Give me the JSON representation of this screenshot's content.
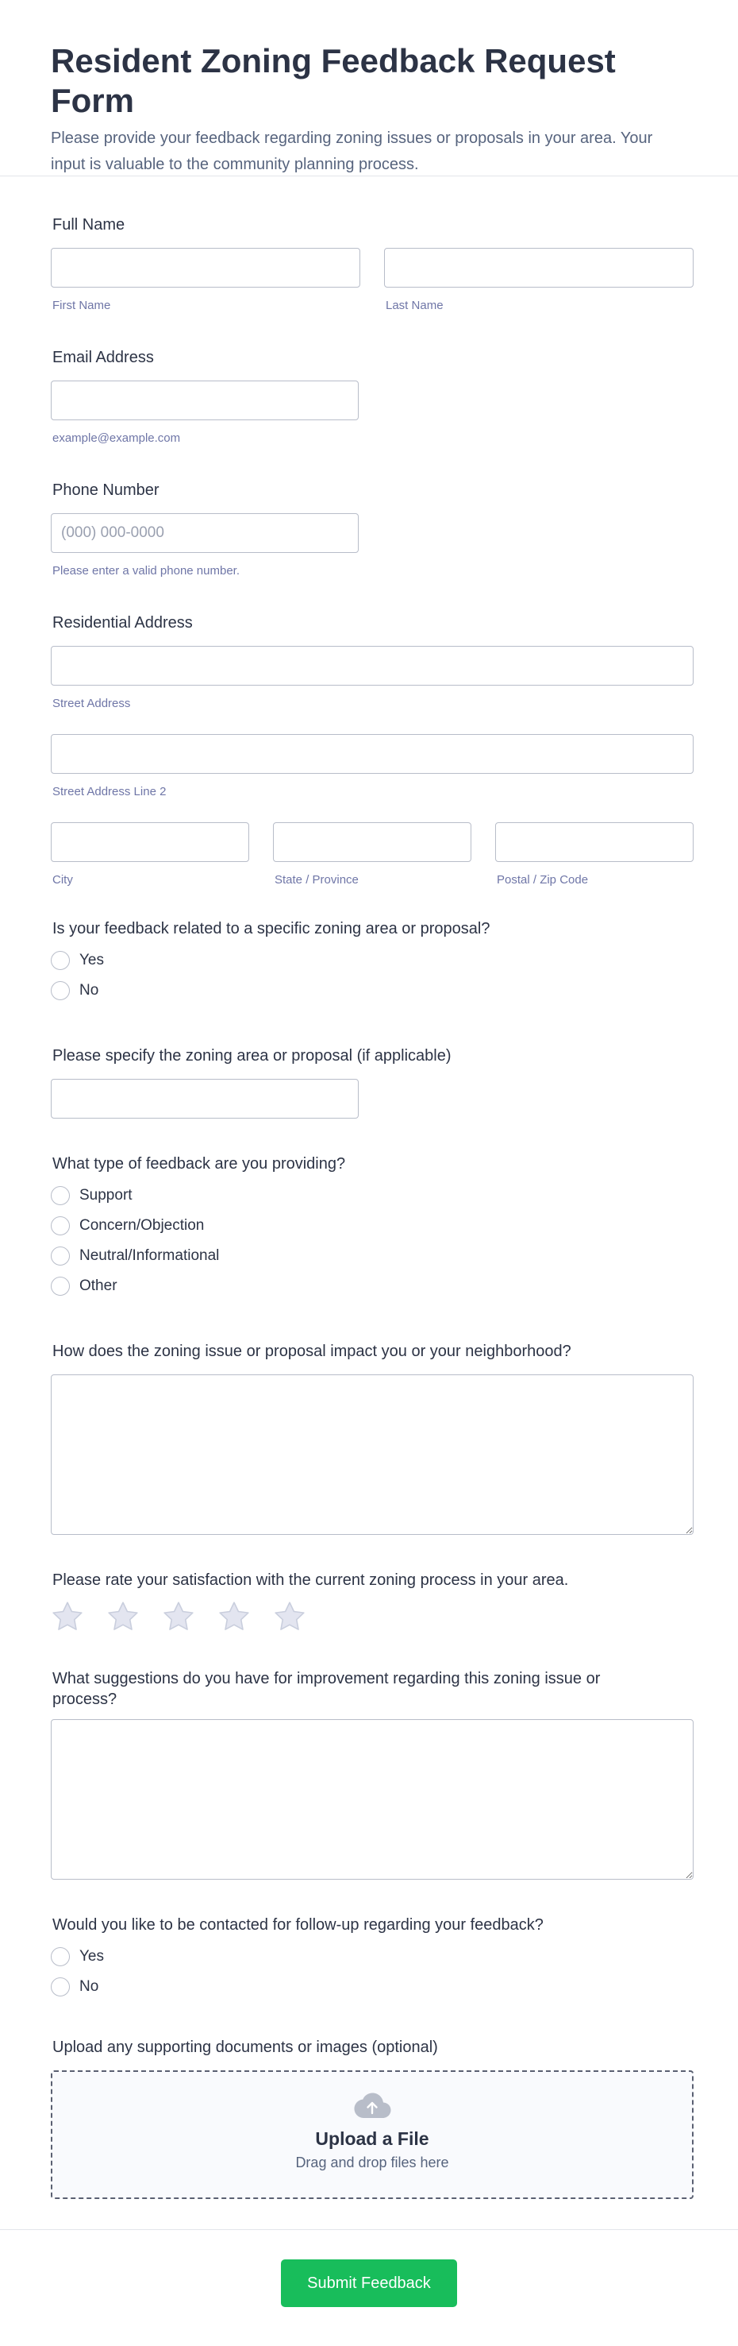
{
  "header": {
    "title": "Resident Zoning Feedback Request Form",
    "description": "Please provide your feedback regarding zoning issues or proposals in your area. Your input is valuable to the community planning process."
  },
  "full_name": {
    "label": "Full Name",
    "first_sublabel": "First Name",
    "last_sublabel": "Last Name",
    "first_value": "",
    "last_value": ""
  },
  "email": {
    "label": "Email Address",
    "sublabel": "example@example.com",
    "value": ""
  },
  "phone": {
    "label": "Phone Number",
    "placeholder": "(000) 000-0000",
    "sublabel": "Please enter a valid phone number."
  },
  "address": {
    "label": "Residential Address",
    "street_sublabel": "Street Address",
    "street2_sublabel": "Street Address Line 2",
    "city_sublabel": "City",
    "state_sublabel": "State / Province",
    "zip_sublabel": "Postal / Zip Code"
  },
  "related": {
    "label": "Is your feedback related to a specific zoning area or proposal?",
    "options": [
      "Yes",
      "No"
    ]
  },
  "specify": {
    "label": "Please specify the zoning area or proposal (if applicable)"
  },
  "feedback_type": {
    "label": "What type of feedback are you providing?",
    "options": [
      "Support",
      "Concern/Objection",
      "Neutral/Informational",
      "Other"
    ]
  },
  "impact": {
    "label": "How does the zoning issue or proposal impact you or your neighborhood?"
  },
  "rating": {
    "label": "Please rate your satisfaction with the current zoning process in your area.",
    "value": 0,
    "max": 5,
    "star_color": "#e3e5f0",
    "star_stroke": "#c9cedd"
  },
  "suggestions": {
    "label": "What suggestions do you have for improvement regarding this zoning issue or process?"
  },
  "followup": {
    "label": "Would you like to be contacted for follow-up regarding your feedback?",
    "options": [
      "Yes",
      "No"
    ]
  },
  "upload": {
    "label": "Upload any supporting documents or images (optional)",
    "icon": "cloud-upload-icon",
    "title": "Upload a File",
    "subtitle": "Drag and drop files here"
  },
  "submit": {
    "label": "Submit Feedback",
    "color": "#18bd5b"
  }
}
